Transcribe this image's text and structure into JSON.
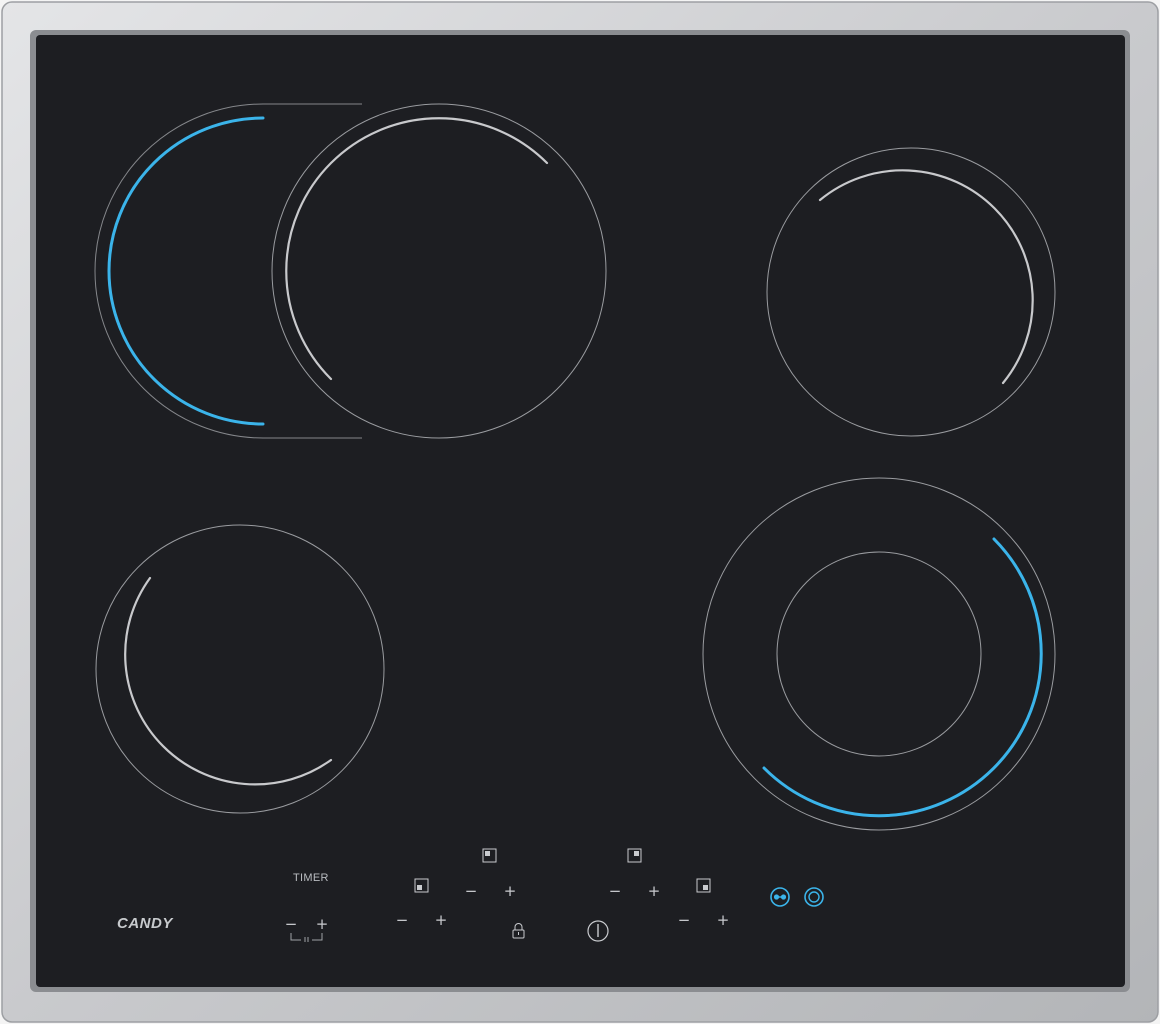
{
  "brand": {
    "name": "CANDY"
  },
  "controls": {
    "timer_label": "TIMER",
    "minus": "−",
    "plus": "+"
  },
  "colors": {
    "glass": "#1d1e22",
    "frame": "#cfd0d2",
    "active_arc": "#3bb4ea",
    "idle_arc": "#c8c9cc",
    "zone_outline": "#9a9ca0"
  },
  "zones": [
    {
      "name": "rear-left-oval-zone",
      "state": "dual-zone extension active"
    },
    {
      "name": "rear-left-main-zone",
      "state": "idle"
    },
    {
      "name": "rear-right-zone",
      "state": "idle"
    },
    {
      "name": "front-left-zone",
      "state": "idle"
    },
    {
      "name": "front-right-dual-zone",
      "state": "active"
    }
  ],
  "icons": [
    "zone-selector-icon",
    "lock-icon",
    "power-icon",
    "oval-zone-icon",
    "dual-zone-icon"
  ]
}
